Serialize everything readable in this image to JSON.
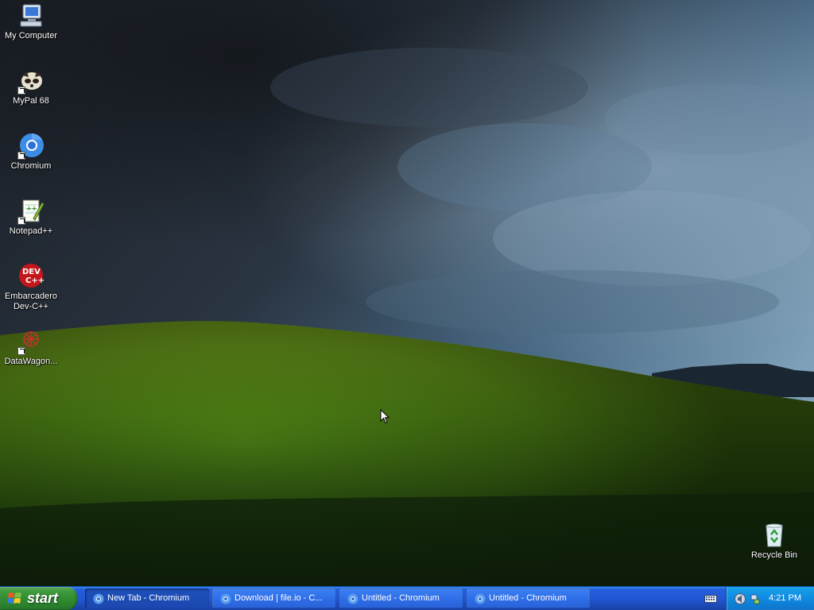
{
  "desktop": {
    "icons": [
      {
        "label": "My Computer",
        "icon": "my-computer-icon"
      },
      {
        "label": "MyPal 68",
        "icon": "mypal-icon"
      },
      {
        "label": "Chromium",
        "icon": "chromium-icon"
      },
      {
        "label": "Notepad++",
        "icon": "notepad-plus-plus-icon"
      },
      {
        "label": "Embarcadero Dev-C++",
        "icon": "dev-cpp-icon"
      },
      {
        "label": "DataWagon...",
        "icon": "datawagon-icon"
      },
      {
        "label": "Recycle Bin",
        "icon": "recycle-bin-icon"
      }
    ]
  },
  "taskbar": {
    "start_label": "start",
    "tasks": [
      {
        "label": "New Tab - Chromium",
        "active": true
      },
      {
        "label": "Download | file.io - C...",
        "active": false
      },
      {
        "label": "Untitled - Chromium",
        "active": false
      },
      {
        "label": "Untitled - Chromium",
        "active": false
      }
    ],
    "clock": "4:21 PM"
  },
  "colors": {
    "taskbar_blue": "#245edc",
    "start_green": "#3c9a3c",
    "tray_blue": "#0f8ae0"
  }
}
